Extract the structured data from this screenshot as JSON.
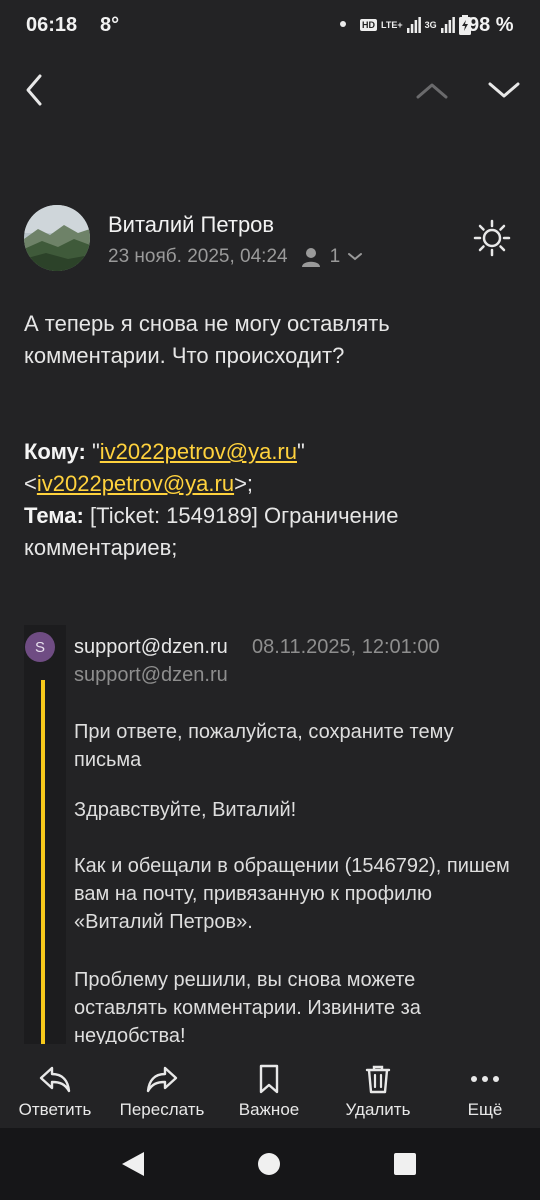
{
  "status_bar": {
    "time": "06:18",
    "temperature": "8°",
    "network_labels": [
      "HD",
      "LTE+",
      "3G"
    ],
    "battery_percent": "98 %"
  },
  "header": {
    "back_icon": "chevron-left-icon",
    "prev_icon": "chevron-up-icon",
    "next_icon": "chevron-down-icon"
  },
  "message": {
    "sender_name": "Виталий Петров",
    "date": "23 нояб. 2025, 04:24",
    "recipients_count": "1",
    "body": "А теперь я снова не могу оставлять комментарии. Что происходит?",
    "to_label": "Кому:",
    "to_quote_open": "\"",
    "to_email": "iv2022petrov@ya.ru",
    "to_quote_close": "\"",
    "to_bracket_open": "<",
    "to_email_2": "iv2022petrov@ya.ru",
    "to_bracket_close": ">;",
    "subject_label": "Тема:",
    "subject_value": "[Ticket: 1549189] Ограничение комментариев;"
  },
  "quoted": {
    "avatar_letter": "S",
    "from": "support@dzen.ru",
    "date": "08.11.2025, 12:01:00",
    "address": "support@dzen.ru",
    "paragraphs": [
      "При ответе, пожалуйста, сохраните тему письма",
      "Здравствуйте, Виталий!",
      "Как и обещали в обращении (1546792), пишем вам на почту, привязанную к профилю «Виталий Петров».",
      "Проблему решили, вы снова можете оставлять комментарии. Извините за неудобства!"
    ]
  },
  "toolbar": {
    "reply": "Ответить",
    "forward": "Переслать",
    "important": "Важное",
    "delete": "Удалить",
    "more": "Ещё"
  },
  "colors": {
    "background": "#232325",
    "link": "#ffd23d",
    "quote_bar": "#f7c91b",
    "avatar_s": "#6f4c83"
  }
}
